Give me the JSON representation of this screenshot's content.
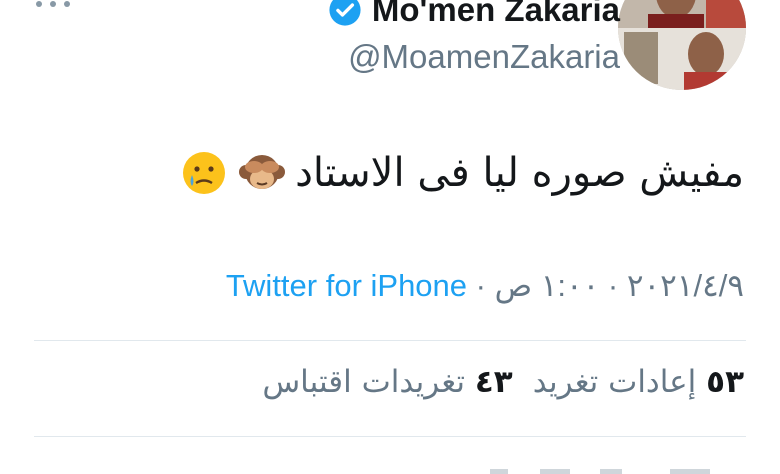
{
  "author": {
    "display_name": "Mo'men Zakaria",
    "handle": "@MoamenZakaria"
  },
  "tweet": {
    "text": "مفيش صوره ليا فى الاستاد",
    "emojis": [
      "see-no-evil-monkey",
      "crying-face"
    ]
  },
  "meta": {
    "date": "٢٠٢١/٤/٩",
    "separator": "·",
    "time": "١:٠٠ ص",
    "source": "Twitter for iPhone"
  },
  "stats": {
    "retweets_count": "٥٣",
    "retweets_label": "إعادات تغريد",
    "quotes_count": "٤٣",
    "quotes_label": "تغريدات اقتباس"
  },
  "colors": {
    "link": "#1da1f2",
    "muted": "#657786",
    "divider": "#e1e8ed",
    "verified": "#1da1f2"
  }
}
